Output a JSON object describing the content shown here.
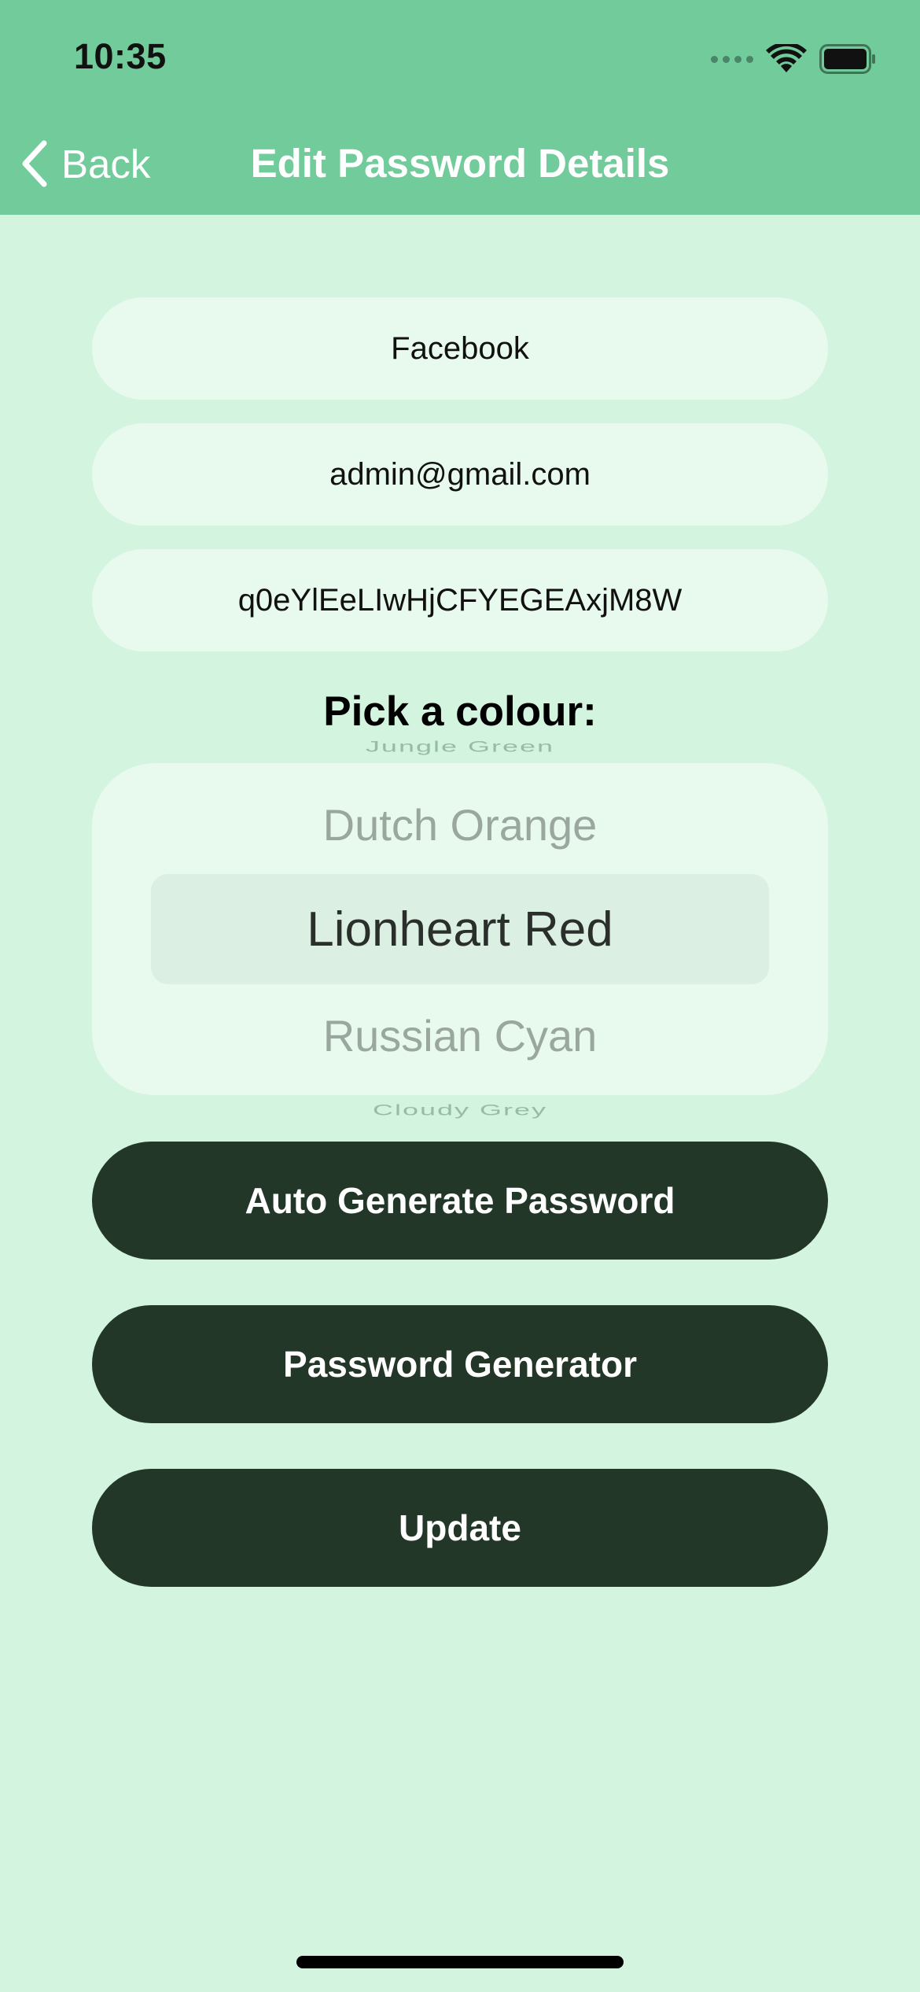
{
  "status_bar": {
    "time": "10:35"
  },
  "nav": {
    "back_label": "Back",
    "title": "Edit Password Details"
  },
  "fields": {
    "site": "Facebook",
    "email": "admin@gmail.com",
    "password": "q0eYlEeLIwHjCFYEGEAxjM8W"
  },
  "colour_picker": {
    "label": "Pick a colour:",
    "above_far": "Jungle Green",
    "above": "Dutch Orange",
    "selected": "Lionheart Red",
    "below": "Russian Cyan",
    "below_far": "Cloudy Grey"
  },
  "buttons": {
    "auto_generate": "Auto Generate Password",
    "generator": "Password Generator",
    "update": "Update"
  },
  "colors": {
    "nav_bar": "#72cb9a",
    "background": "#d3f4df",
    "field": "#e8f9ee",
    "button": "#223728"
  },
  "icons": [
    "chevron-left-icon",
    "cellular-signal-icon",
    "wifi-icon",
    "battery-icon"
  ]
}
